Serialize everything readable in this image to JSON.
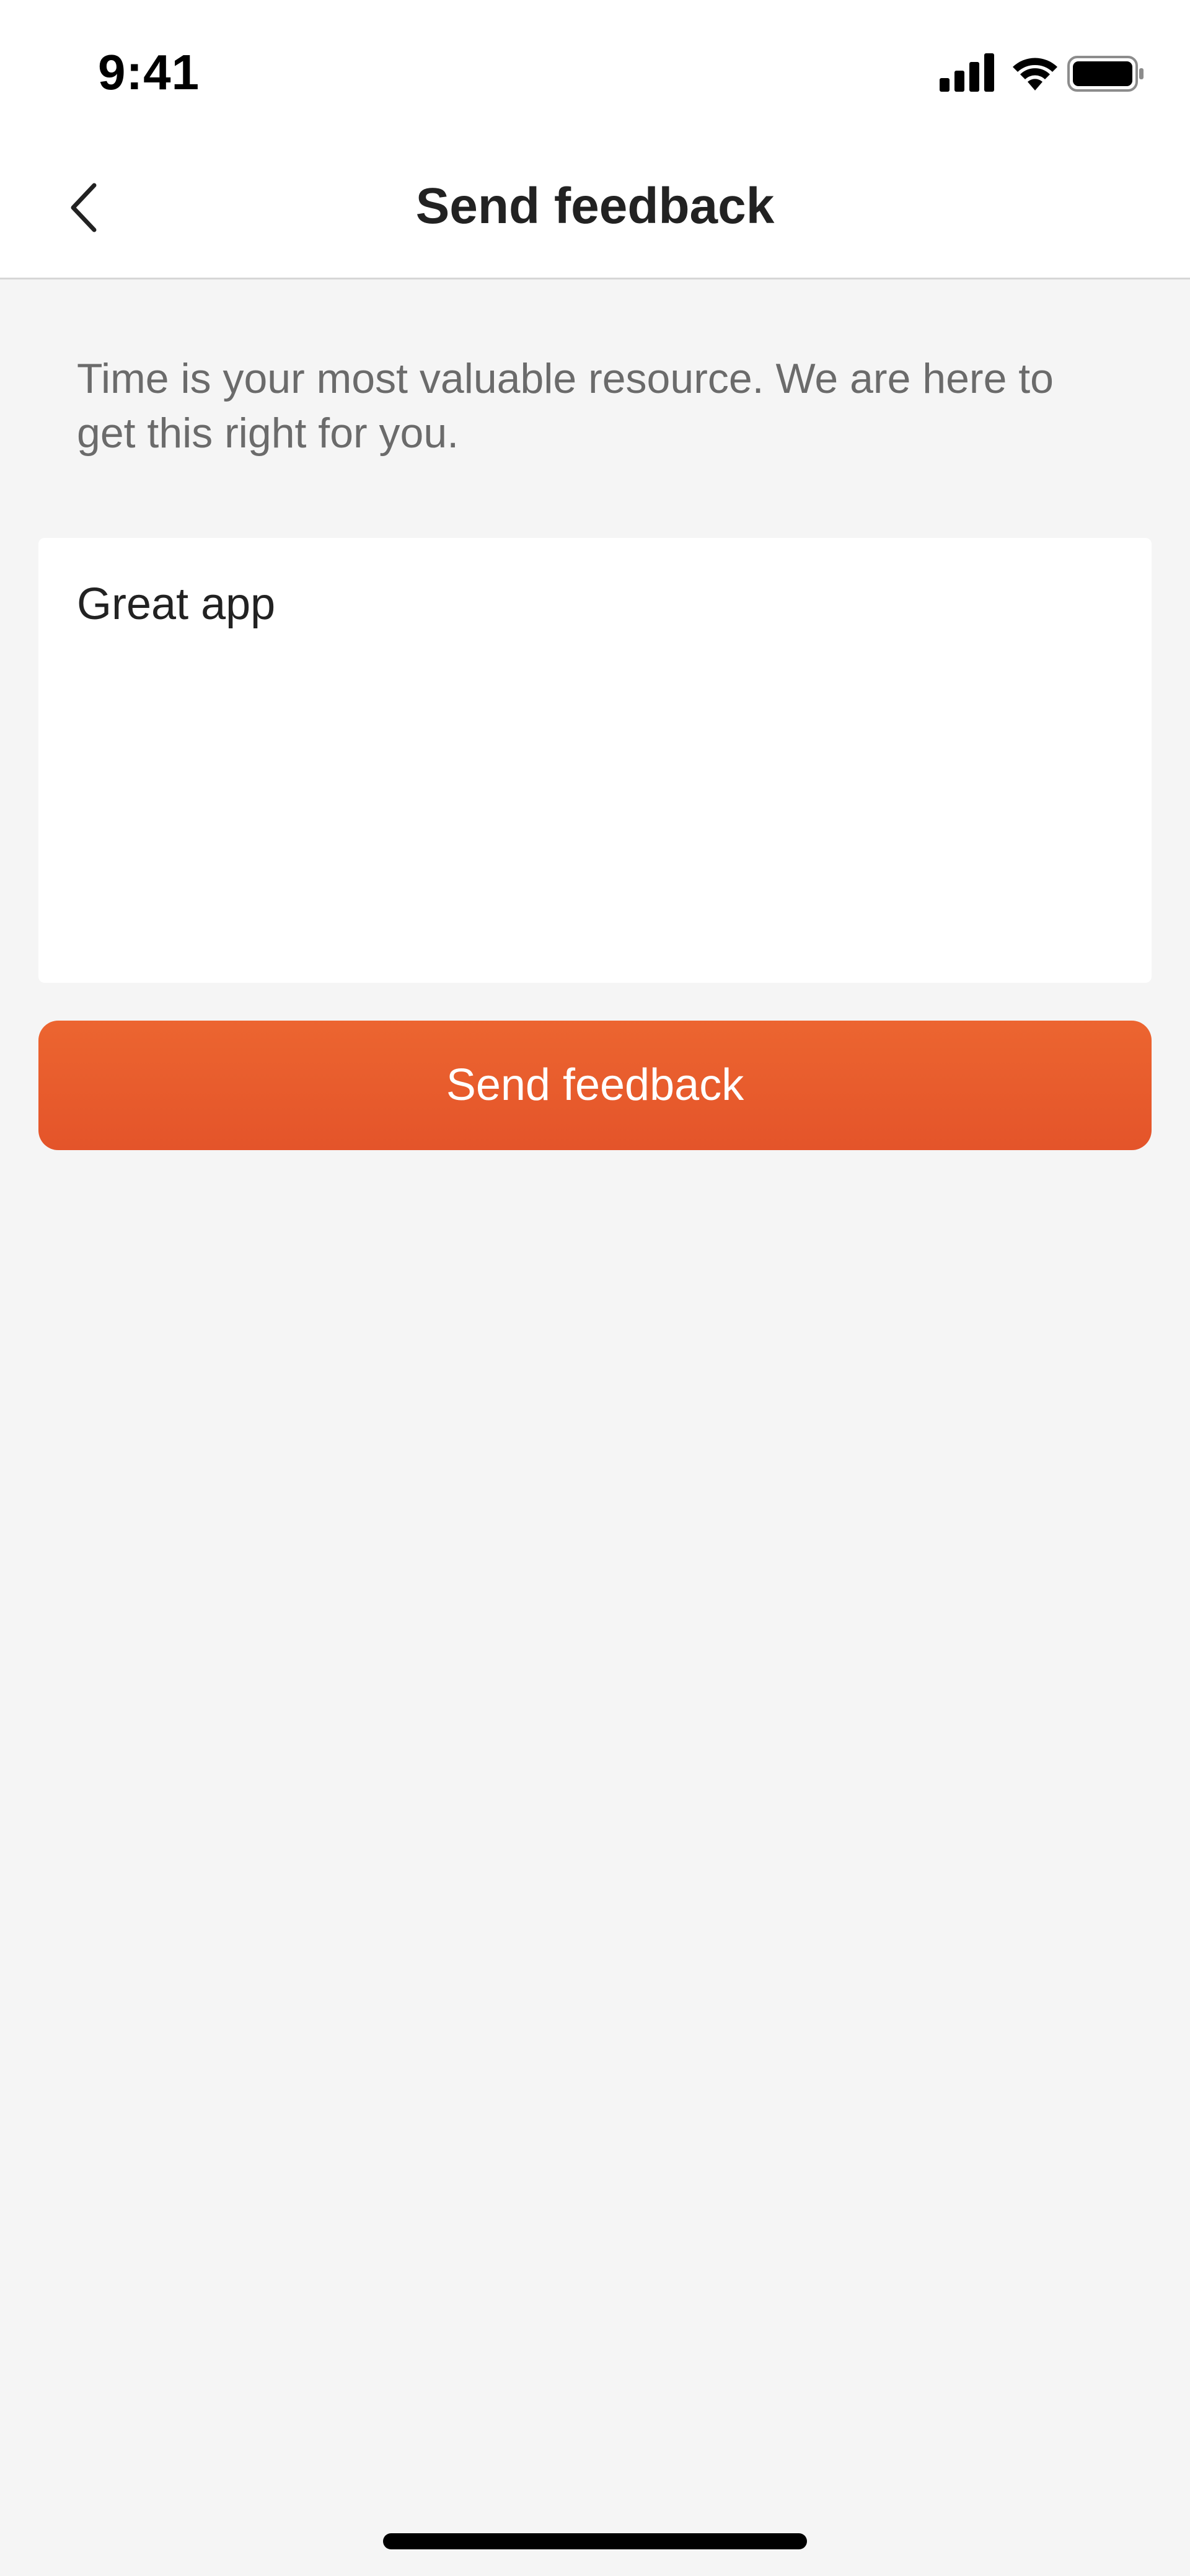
{
  "status_bar": {
    "time": "9:41",
    "icons": [
      "signal-icon",
      "wifi-icon",
      "battery-icon"
    ]
  },
  "nav": {
    "title": "Send feedback",
    "back_icon": "chevron-left-icon"
  },
  "intro": {
    "text": "Time is your most valuable resource. We are here to get this right for you."
  },
  "feedback_field": {
    "value": "Great app"
  },
  "send_button": {
    "label": "Send feedback"
  },
  "colors": {
    "accent": "#E85A2C",
    "background": "#F5F5F5",
    "surface": "#FFFFFF",
    "secondary_text": "#6B6B6B"
  }
}
